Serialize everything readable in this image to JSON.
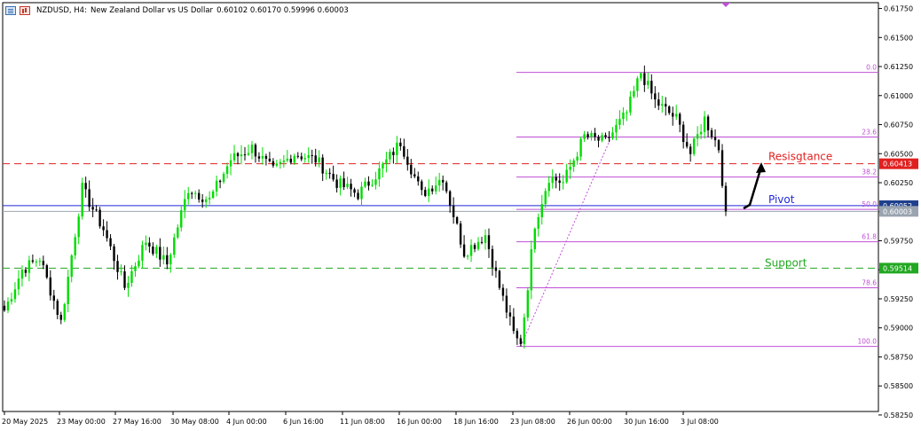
{
  "header": {
    "symbol": "NZDUSD, H4:",
    "description": "New Zealand Dollar vs US Dollar",
    "ohlc": "0.60102 0.60170 0.59996 0.60003"
  },
  "icons": [
    "chart-properties-icon",
    "chart-data-icon",
    "new-bar-marker-icon",
    "long-arrow-icon"
  ],
  "colors": {
    "bull": "#00dc00",
    "bear": "#000000",
    "fib": "#c04fd6",
    "resistance": "#e02020",
    "support": "#22a822",
    "pivot": "#2028d8",
    "bid_tag": "#1f3f8c"
  },
  "chart_data": {
    "type": "candlestick",
    "symbol": "NZDUSD",
    "timeframe": "H4",
    "y_ticks": [
      "0.61750",
      "0.61500",
      "0.61250",
      "0.61000",
      "0.60750",
      "0.60500",
      "0.60250",
      "0.60000",
      "0.59750",
      "0.59500",
      "0.59250",
      "0.59000",
      "0.58750",
      "0.58500",
      "0.58250"
    ],
    "x_ticks": [
      "20 May 2025",
      "23 May 00:00",
      "27 May 16:00",
      "30 May 08:00",
      "4 Jun 00:00",
      "6 Jun 16:00",
      "11 Jun 08:00",
      "16 Jun 00:00",
      "18 Jun 16:00",
      "23 Jun 08:00",
      "26 Jun 00:00",
      "30 Jun 16:00",
      "3 Jul 08:00"
    ],
    "price_tags": [
      {
        "label": "0.60413",
        "price": 0.60413,
        "color": "#e02020"
      },
      {
        "label": "0.60052",
        "price": 0.60052,
        "color": "#1f3f8c"
      },
      {
        "label": "0.60003",
        "price": 0.60003,
        "color": "#9aa4b0"
      },
      {
        "label": "0.59514",
        "price": 0.59514,
        "color": "#22a822"
      }
    ],
    "levels": [
      {
        "name": "Resisgtance",
        "price": 0.60413,
        "color": "#e02020"
      },
      {
        "name": "Pivot",
        "price": 0.60052,
        "color": "#2028d8"
      },
      {
        "name": "Support",
        "price": 0.59514,
        "color": "#22a822"
      }
    ],
    "fibonacci": {
      "high": 0.612,
      "low": 0.5884,
      "levels": [
        "0.0",
        "23.6",
        "38.2",
        "50.0",
        "61.8",
        "78.6",
        "100.0"
      ],
      "ratios": [
        0,
        0.236,
        0.382,
        0.5,
        0.618,
        0.786,
        1.0
      ]
    },
    "anchors": [
      {
        "t": 0,
        "p": 0.5915
      },
      {
        "t": 5,
        "p": 0.595
      },
      {
        "t": 10,
        "p": 0.596
      },
      {
        "t": 16,
        "p": 0.5905
      },
      {
        "t": 22,
        "p": 0.602
      },
      {
        "t": 28,
        "p": 0.5985
      },
      {
        "t": 34,
        "p": 0.5935
      },
      {
        "t": 40,
        "p": 0.5975
      },
      {
        "t": 46,
        "p": 0.5955
      },
      {
        "t": 52,
        "p": 0.602
      },
      {
        "t": 58,
        "p": 0.601
      },
      {
        "t": 64,
        "p": 0.6045
      },
      {
        "t": 70,
        "p": 0.6055
      },
      {
        "t": 76,
        "p": 0.6035
      },
      {
        "t": 82,
        "p": 0.605
      },
      {
        "t": 88,
        "p": 0.6045
      },
      {
        "t": 94,
        "p": 0.6025
      },
      {
        "t": 100,
        "p": 0.6015
      },
      {
        "t": 106,
        "p": 0.6035
      },
      {
        "t": 112,
        "p": 0.606
      },
      {
        "t": 118,
        "p": 0.6015
      },
      {
        "t": 124,
        "p": 0.603
      },
      {
        "t": 130,
        "p": 0.5965
      },
      {
        "t": 136,
        "p": 0.598
      },
      {
        "t": 140,
        "p": 0.5935
      },
      {
        "t": 144,
        "p": 0.5895
      },
      {
        "t": 146,
        "p": 0.5884
      },
      {
        "t": 150,
        "p": 0.599
      },
      {
        "t": 154,
        "p": 0.603
      },
      {
        "t": 158,
        "p": 0.6025
      },
      {
        "t": 164,
        "p": 0.6065
      },
      {
        "t": 170,
        "p": 0.606
      },
      {
        "t": 176,
        "p": 0.6085
      },
      {
        "t": 180,
        "p": 0.612
      },
      {
        "t": 184,
        "p": 0.6095
      },
      {
        "t": 190,
        "p": 0.608
      },
      {
        "t": 194,
        "p": 0.605
      },
      {
        "t": 198,
        "p": 0.608
      },
      {
        "t": 202,
        "p": 0.6055
      },
      {
        "t": 204,
        "p": 0.6
      }
    ],
    "y_range": [
      0.5828,
      0.618
    ]
  }
}
